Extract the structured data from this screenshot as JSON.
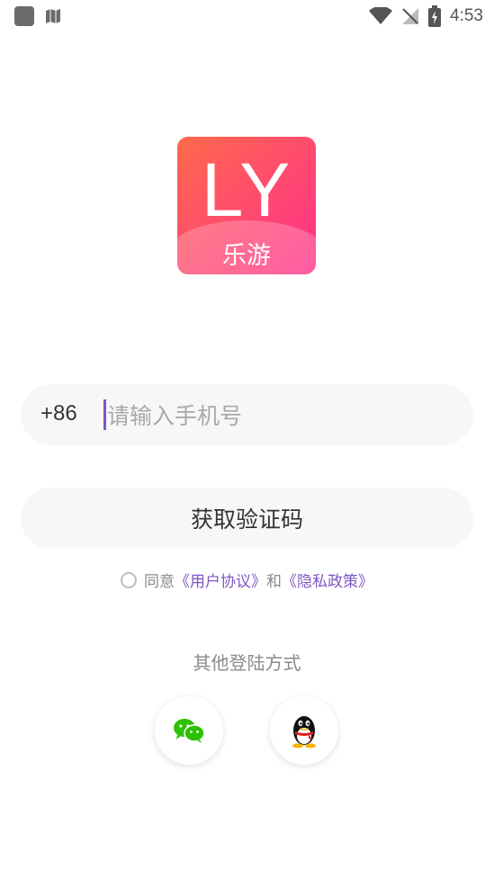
{
  "status_bar": {
    "time": "4:53",
    "icons": [
      "app-icon",
      "map-icon",
      "wifi-icon",
      "no-signal-icon",
      "battery-charging-icon"
    ]
  },
  "logo": {
    "letters": "LY",
    "subtitle": "乐游",
    "gradient_start": "#ff6a4a",
    "gradient_end": "#ff2f8a"
  },
  "login": {
    "country_code": "+86",
    "phone_placeholder": "请输入手机号",
    "phone_value": "",
    "get_code_label": "获取验证码"
  },
  "agreement": {
    "prefix": "同意",
    "user_agreement": "《用户协议》",
    "conjunction": "和",
    "privacy_policy": "《隐私政策》",
    "accent_color": "#7e57c2"
  },
  "other_login": {
    "title": "其他登陆方式",
    "buttons": [
      "wechat-icon",
      "qq-icon"
    ]
  }
}
